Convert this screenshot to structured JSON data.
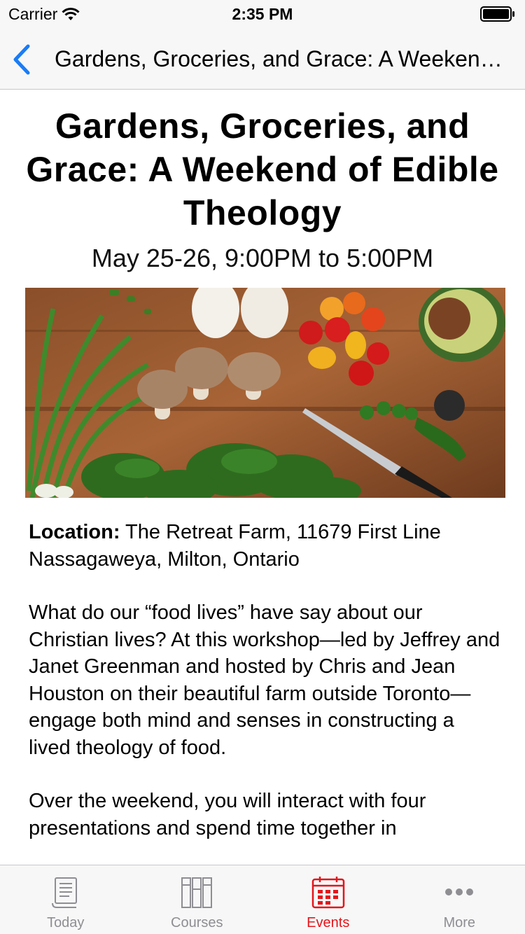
{
  "status_bar": {
    "carrier": "Carrier",
    "time": "2:35 PM",
    "icons": [
      "wifi-icon",
      "battery-icon"
    ]
  },
  "nav": {
    "title": "Gardens, Groceries, and Grace: A Weekend of Edible Theology",
    "back_icon": "chevron-left-icon"
  },
  "event": {
    "title": "Gardens, Groceries, and Grace: A Weekend of Edible Theology",
    "date": "May 25-26, 9:00PM to 5:00PM",
    "location_label": "Location:",
    "location_value": "The Retreat Farm, 11679 First Line Nassagaweya, Milton, Ontario",
    "paragraphs": [
      "What do our “food lives” have say about our Christian lives? At this workshop—led by Jeffrey and Janet Greenman and hosted by Chris and Jean Houston on their beautiful farm outside Toronto—engage both mind and senses in constructing a lived theology of food.",
      "Over the weekend, you will interact with four presentations and spend time together in"
    ]
  },
  "tabs": [
    {
      "label": "Today",
      "icon": "scroll-icon",
      "active": false
    },
    {
      "label": "Courses",
      "icon": "books-icon",
      "active": false
    },
    {
      "label": "Events",
      "icon": "calendar-icon",
      "active": true
    },
    {
      "label": "More",
      "icon": "more-dots-icon",
      "active": false
    }
  ],
  "colors": {
    "accent_blue": "#1a7cf5",
    "active_tab": "#e3161b",
    "inactive_tab": "#8e8e93",
    "bar_background": "#f7f7f7"
  }
}
